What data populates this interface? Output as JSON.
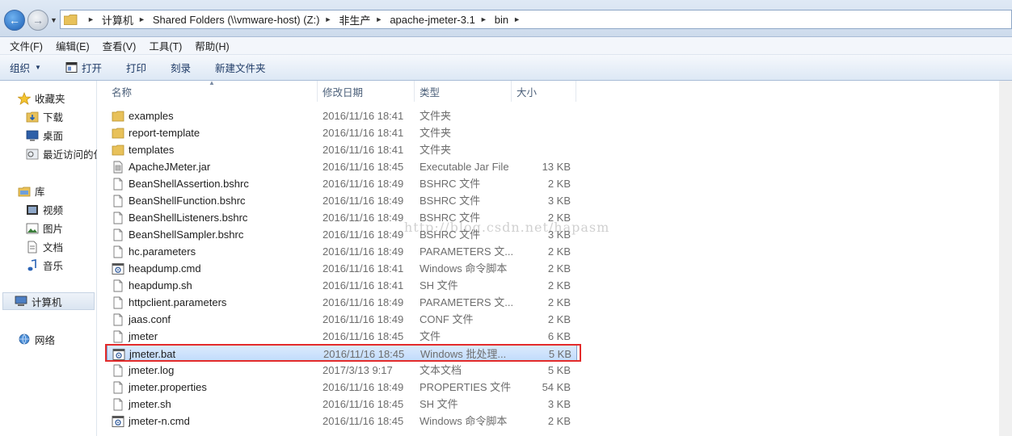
{
  "address": {
    "crumbs": [
      "计算机",
      "Shared Folders (\\\\vmware-host) (Z:)",
      "非生产",
      "apache-jmeter-3.1",
      "bin"
    ]
  },
  "menu": [
    "文件(F)",
    "编辑(E)",
    "查看(V)",
    "工具(T)",
    "帮助(H)"
  ],
  "toolbar": {
    "organize": "组织",
    "open": "打开",
    "print": "打印",
    "burn": "刻录",
    "new_folder": "新建文件夹"
  },
  "sidebar": {
    "favorites": "收藏夹",
    "downloads": "下载",
    "desktop": "桌面",
    "recent": "最近访问的位置",
    "libraries": "库",
    "videos": "视频",
    "pictures": "图片",
    "documents": "文档",
    "music": "音乐",
    "computer": "计算机",
    "network": "网络"
  },
  "columns": {
    "name": "名称",
    "date": "修改日期",
    "type": "类型",
    "size": "大小"
  },
  "files": [
    {
      "name": "examples",
      "date": "2016/11/16 18:41",
      "type": "文件夹",
      "size": "",
      "icon": "folder"
    },
    {
      "name": "report-template",
      "date": "2016/11/16 18:41",
      "type": "文件夹",
      "size": "",
      "icon": "folder"
    },
    {
      "name": "templates",
      "date": "2016/11/16 18:41",
      "type": "文件夹",
      "size": "",
      "icon": "folder"
    },
    {
      "name": "ApacheJMeter.jar",
      "date": "2016/11/16 18:45",
      "type": "Executable Jar File",
      "size": "13 KB",
      "icon": "jar"
    },
    {
      "name": "BeanShellAssertion.bshrc",
      "date": "2016/11/16 18:49",
      "type": "BSHRC 文件",
      "size": "2 KB",
      "icon": "file"
    },
    {
      "name": "BeanShellFunction.bshrc",
      "date": "2016/11/16 18:49",
      "type": "BSHRC 文件",
      "size": "3 KB",
      "icon": "file"
    },
    {
      "name": "BeanShellListeners.bshrc",
      "date": "2016/11/16 18:49",
      "type": "BSHRC 文件",
      "size": "2 KB",
      "icon": "file"
    },
    {
      "name": "BeanShellSampler.bshrc",
      "date": "2016/11/16 18:49",
      "type": "BSHRC 文件",
      "size": "3 KB",
      "icon": "file"
    },
    {
      "name": "hc.parameters",
      "date": "2016/11/16 18:49",
      "type": "PARAMETERS 文...",
      "size": "2 KB",
      "icon": "file"
    },
    {
      "name": "heapdump.cmd",
      "date": "2016/11/16 18:41",
      "type": "Windows 命令脚本",
      "size": "2 KB",
      "icon": "gear"
    },
    {
      "name": "heapdump.sh",
      "date": "2016/11/16 18:41",
      "type": "SH 文件",
      "size": "2 KB",
      "icon": "file"
    },
    {
      "name": "httpclient.parameters",
      "date": "2016/11/16 18:49",
      "type": "PARAMETERS 文...",
      "size": "2 KB",
      "icon": "file"
    },
    {
      "name": "jaas.conf",
      "date": "2016/11/16 18:49",
      "type": "CONF 文件",
      "size": "2 KB",
      "icon": "file"
    },
    {
      "name": "jmeter",
      "date": "2016/11/16 18:45",
      "type": "文件",
      "size": "6 KB",
      "icon": "file"
    },
    {
      "name": "jmeter.bat",
      "date": "2016/11/16 18:45",
      "type": "Windows 批处理...",
      "size": "5 KB",
      "icon": "gear"
    },
    {
      "name": "jmeter.log",
      "date": "2017/3/13 9:17",
      "type": "文本文档",
      "size": "5 KB",
      "icon": "file"
    },
    {
      "name": "jmeter.properties",
      "date": "2016/11/16 18:49",
      "type": "PROPERTIES 文件",
      "size": "54 KB",
      "icon": "file"
    },
    {
      "name": "jmeter.sh",
      "date": "2016/11/16 18:45",
      "type": "SH 文件",
      "size": "3 KB",
      "icon": "file"
    },
    {
      "name": "jmeter-n.cmd",
      "date": "2016/11/16 18:45",
      "type": "Windows 命令脚本",
      "size": "2 KB",
      "icon": "gear"
    }
  ],
  "selected_file": "jmeter.bat",
  "watermark": "http://blog.csdn.net/hapasm"
}
